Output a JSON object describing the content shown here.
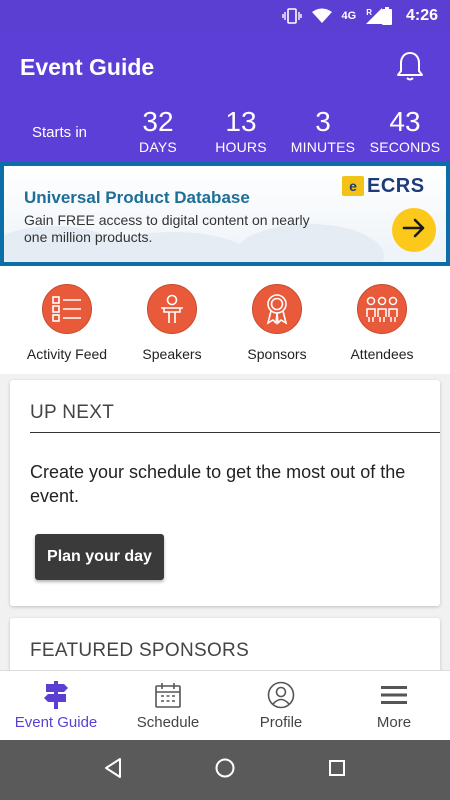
{
  "status_bar": {
    "network": "4G",
    "roaming": "R",
    "time": "4:26"
  },
  "header": {
    "title": "Event Guide",
    "bell_icon": "bell-icon"
  },
  "countdown": {
    "starts_in_label": "Starts in",
    "units": [
      {
        "value": "32",
        "label": "DAYS"
      },
      {
        "value": "13",
        "label": "HOURS"
      },
      {
        "value": "3",
        "label": "MINUTES"
      },
      {
        "value": "43",
        "label": "SECONDS"
      }
    ]
  },
  "banner": {
    "title": "Universal Product Database",
    "subtitle": "Gain FREE access to digital content on nearly one million products.",
    "brand": "ECRS",
    "brand_mark": "e",
    "arrow_icon": "arrow-right-icon"
  },
  "quick_actions": [
    {
      "label": "Activity Feed",
      "icon": "activity-feed-icon"
    },
    {
      "label": "Speakers",
      "icon": "speaker-icon"
    },
    {
      "label": "Sponsors",
      "icon": "award-ribbon-icon"
    },
    {
      "label": "Attendees",
      "icon": "attendees-icon"
    }
  ],
  "up_next": {
    "title": "UP NEXT",
    "text": "Create your schedule to get the most out of the event.",
    "button_label": "Plan your day"
  },
  "featured_sponsors": {
    "title": "FEATURED SPONSORS"
  },
  "bottom_nav": [
    {
      "label": "Event Guide",
      "icon": "signpost-icon",
      "active": true
    },
    {
      "label": "Schedule",
      "icon": "calendar-icon",
      "active": false
    },
    {
      "label": "Profile",
      "icon": "profile-icon",
      "active": false
    },
    {
      "label": "More",
      "icon": "menu-icon",
      "active": false
    }
  ],
  "colors": {
    "primary": "#5c3fd7",
    "accent": "#e85a3a",
    "banner_border": "#0b6ea8",
    "arrow_button": "#fcc91a"
  }
}
